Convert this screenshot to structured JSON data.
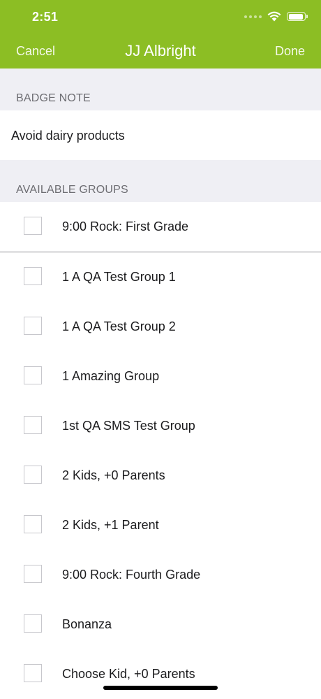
{
  "status_bar": {
    "time": "2:51"
  },
  "nav": {
    "cancel_label": "Cancel",
    "title": "JJ Albright",
    "done_label": "Done",
    "background_color": "#8cbe24"
  },
  "badge_note": {
    "header": "BADGE NOTE",
    "value": "Avoid dairy products"
  },
  "groups": {
    "header": "AVAILABLE GROUPS",
    "items": [
      {
        "label": "9:00 Rock: First Grade",
        "checked": false
      },
      {
        "label": "1 A QA Test Group 1",
        "checked": false
      },
      {
        "label": "1 A QA Test Group 2",
        "checked": false
      },
      {
        "label": "1 Amazing Group",
        "checked": false
      },
      {
        "label": "1st QA SMS Test Group",
        "checked": false
      },
      {
        "label": "2 Kids, +0 Parents",
        "checked": false
      },
      {
        "label": "2 Kids, +1 Parent",
        "checked": false
      },
      {
        "label": "9:00 Rock: Fourth Grade",
        "checked": false
      },
      {
        "label": "Bonanza",
        "checked": false
      },
      {
        "label": "Choose Kid, +0 Parents",
        "checked": false
      }
    ]
  }
}
